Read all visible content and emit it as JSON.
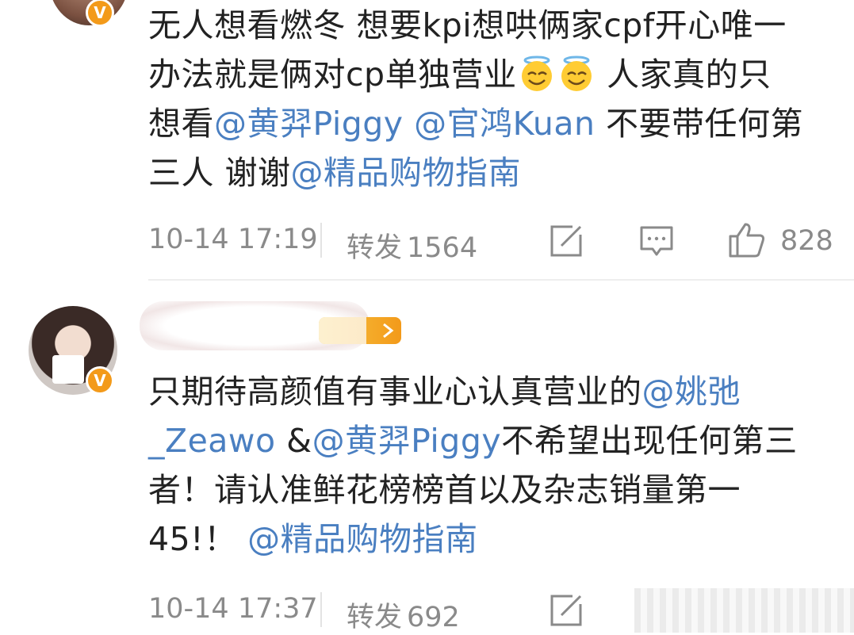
{
  "comments": [
    {
      "verified_badge": "V",
      "lines": {
        "l1": "无人想看燃冬 想要kpi想哄俩家cpf开心唯一",
        "l2a": "办法就是俩对cp单独营业",
        "l2b": " 人家真的只",
        "l3a": "想看",
        "l3_m1": "@黄羿Piggy",
        "l3_m2": " @官鸿Kuan",
        "l3b": " 不要带任何第",
        "l4a": "三人 谢谢",
        "l4_m": "@精品购物指南"
      },
      "timestamp": "10-14 17:19",
      "repost_label": "转发",
      "repost_count": "1564",
      "like_count": "828"
    },
    {
      "verified_badge": "V",
      "lines": {
        "l1a": "只期待高颜值有事业心认真营业的",
        "l1_m": "@姚弛",
        "l2_m": "_Zeawo",
        "l2a": " &",
        "l2_m2": "@黄羿Piggy",
        "l2b": "不希望出现任何第三",
        "l3": "者！请认准鲜花榜榜首以及杂志销量第一",
        "l4a": "45!！",
        "l4_m": " @精品购物指南"
      },
      "timestamp": "10-14 17:37",
      "repost_label": "转发",
      "repost_count": "692"
    }
  ],
  "colors": {
    "mention": "#4a7fc1",
    "text": "#222222",
    "meta": "#8a8a8a",
    "verified": "#f39a1a"
  },
  "icons": [
    "edit-icon",
    "comment-icon",
    "like-icon",
    "angel-emoji"
  ]
}
